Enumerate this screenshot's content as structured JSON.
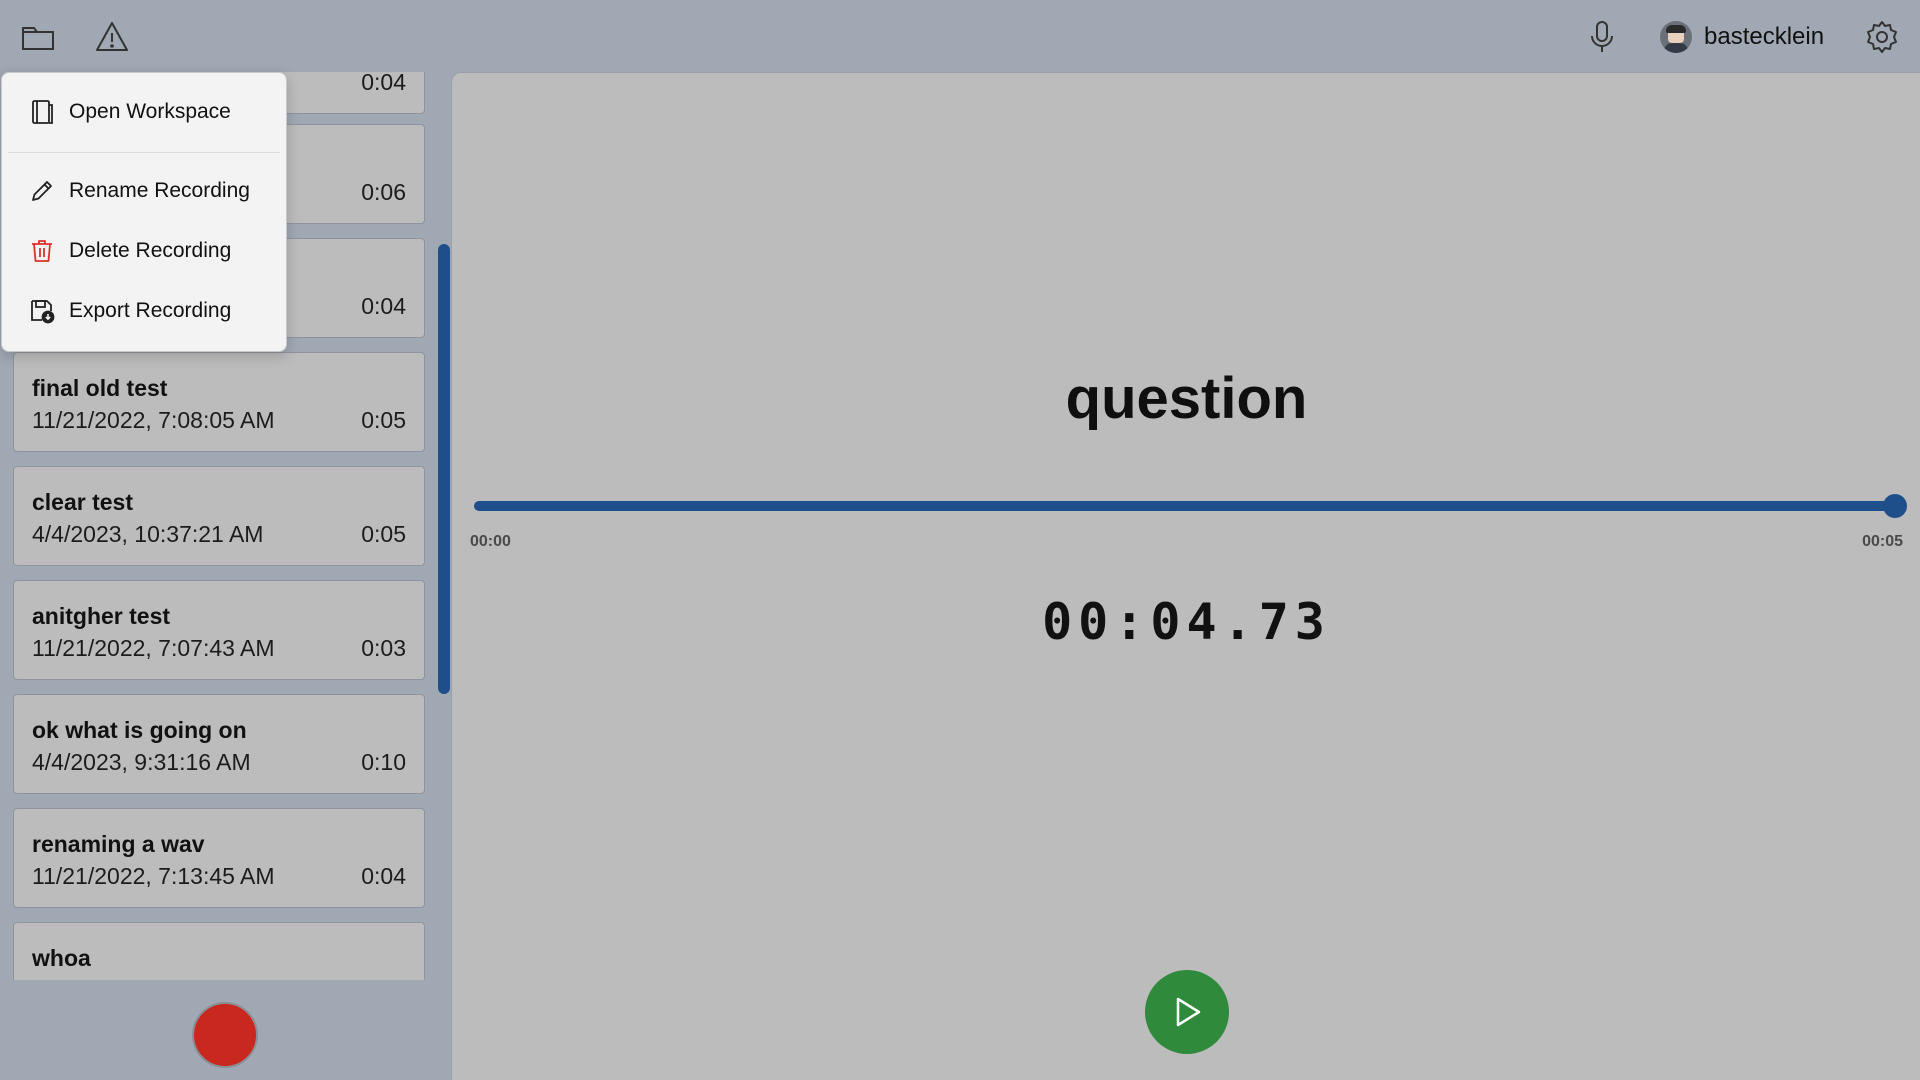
{
  "topbar": {
    "username": "bastecklein",
    "icons": [
      "folder-icon",
      "warning-icon",
      "microphone-icon",
      "settings-icon"
    ]
  },
  "recordings": [
    {
      "name": "",
      "date": "",
      "duration": "0:04"
    },
    {
      "name": "",
      "date": "",
      "duration": "0:06"
    },
    {
      "name": "",
      "date": "",
      "duration": "0:04"
    },
    {
      "name": "final old test",
      "date": "11/21/2022, 7:08:05 AM",
      "duration": "0:05"
    },
    {
      "name": "clear test",
      "date": "4/4/2023, 10:37:21 AM",
      "duration": "0:05"
    },
    {
      "name": "anitgher test",
      "date": "11/21/2022, 7:07:43 AM",
      "duration": "0:03"
    },
    {
      "name": "ok what is going on",
      "date": "4/4/2023, 9:31:16 AM",
      "duration": "0:10"
    },
    {
      "name": "renaming a wav",
      "date": "11/21/2022, 7:13:45 AM",
      "duration": "0:04"
    },
    {
      "name": "whoa",
      "date": "",
      "duration": ""
    }
  ],
  "context_menu": {
    "items": [
      {
        "label": "Open Workspace",
        "icon": "open-workspace-icon"
      },
      {
        "label": "Rename Recording",
        "icon": "pencil-icon"
      },
      {
        "label": "Delete Recording",
        "icon": "trash-icon"
      },
      {
        "label": "Export Recording",
        "icon": "save-export-icon"
      }
    ]
  },
  "player": {
    "title": "question",
    "progress": 1.0,
    "time_start": "00:00",
    "time_end": "00:05",
    "timer": "00:04.73"
  },
  "colors": {
    "background": "#a0a8b3",
    "panel": "#bcbcbc",
    "accent_blue": "#1f4f8a",
    "record_red": "#c8281d",
    "play_green": "#2f8a3b",
    "delete_red": "#d9342b"
  }
}
